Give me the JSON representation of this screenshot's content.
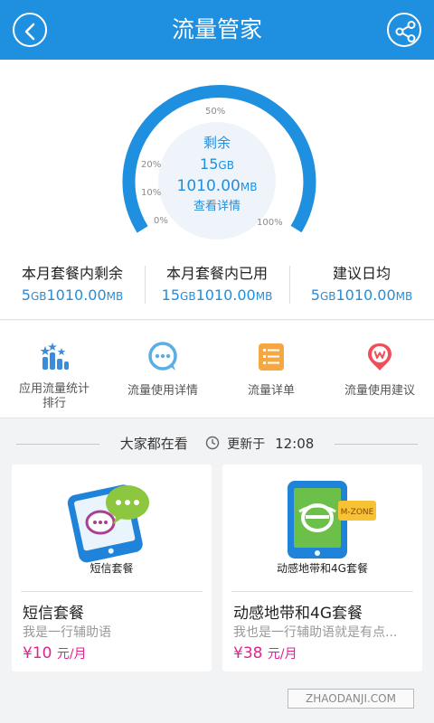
{
  "header": {
    "title": "流量管家",
    "back_icon": "back-arrow-icon",
    "share_icon": "share-icon"
  },
  "gauge": {
    "label": "剩余",
    "amount1": "15",
    "unit1": "GB",
    "amount2": "1010.00",
    "unit2": "MB",
    "link": "查看详情",
    "ticks": {
      "t0": "0%",
      "t10": "10%",
      "t20": "20%",
      "t50": "50%",
      "t100": "100%"
    },
    "fill_color": "#1f8fe0",
    "track_color": "#e3eef8"
  },
  "stats": [
    {
      "title": "本月套餐内剩余",
      "gb": "5",
      "gb_unit": "GB",
      "mb": "1010.00",
      "mb_unit": "MB"
    },
    {
      "title": "本月套餐内已用",
      "gb": "15",
      "gb_unit": "GB",
      "mb": "1010.00",
      "mb_unit": "MB"
    },
    {
      "title": "建议日均",
      "gb": "5",
      "gb_unit": "GB",
      "mb": "1010.00",
      "mb_unit": "MB"
    }
  ],
  "menu": [
    {
      "label_line1": "应用流量统计",
      "label_line2": "排行",
      "icon": "app-ranking-icon"
    },
    {
      "label": "流量使用详情",
      "icon": "chat-bubble-icon"
    },
    {
      "label": "流量详单",
      "icon": "list-icon"
    },
    {
      "label": "流量使用建议",
      "icon": "suggestion-pin-icon"
    }
  ],
  "section": {
    "title": "大家都在看",
    "updated_label": "更新于",
    "time": "12:08"
  },
  "cards": [
    {
      "caption": "短信套餐",
      "name": "短信套餐",
      "subtitle": "我是一行辅助语",
      "currency": "¥",
      "price": "10",
      "per": "元/月"
    },
    {
      "caption": "动感地带和4G套餐",
      "name": "动感地带和4G套餐",
      "subtitle": "我也是一行辅助语就是有点...",
      "currency": "¥",
      "price": "38",
      "per": "元/月"
    }
  ],
  "watermark": "ZHAODANJI.COM"
}
